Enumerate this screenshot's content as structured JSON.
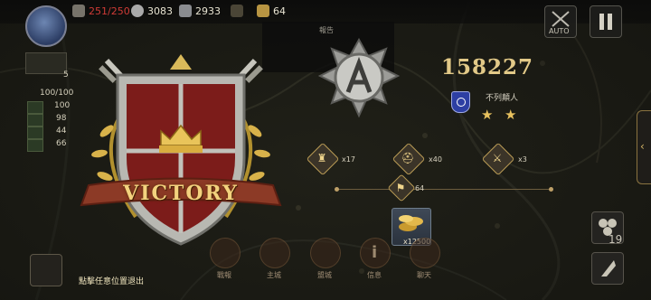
{
  "top_bar": {
    "troops": "251/250",
    "silver": "3083",
    "iron": "2933",
    "flags": "64",
    "auto_label": "AUTO"
  },
  "left_panel": {
    "army_count": "100/100",
    "rows": [
      "100",
      "98",
      "44",
      "66"
    ],
    "side_number": "5"
  },
  "report": {
    "tab_label": "報告"
  },
  "result": {
    "banner_text": "VICTORY",
    "score": "158227",
    "rank_name": "不列顛人",
    "stars": 2
  },
  "rewards": [
    {
      "name": "castle",
      "count": "x17",
      "icon": "castle-icon"
    },
    {
      "name": "helmet",
      "count": "x40",
      "icon": "helmet-icon"
    },
    {
      "name": "swords",
      "count": "x3",
      "icon": "swords-icon"
    }
  ],
  "reward_flags": "64",
  "reward_gold": "x12500",
  "toolbar": {
    "items": [
      "戰報",
      "主城",
      "盟城",
      "信息",
      "聊天"
    ],
    "exit_hint": "點擊任意位置退出"
  },
  "right_panel": {
    "troop_count": "19"
  },
  "colors": {
    "accent_gold": "#e2c988",
    "victory_red": "#7c1c1a",
    "warning_red": "#cf3b36"
  }
}
